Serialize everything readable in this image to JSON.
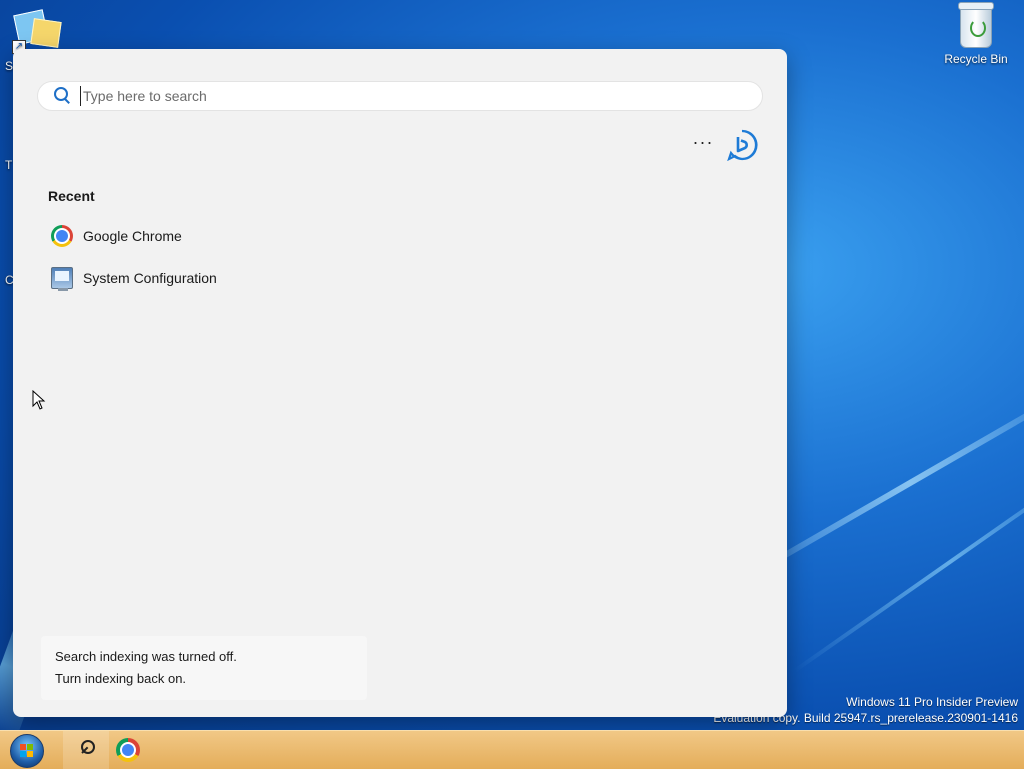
{
  "desktop": {
    "recycle_bin_label": "Recycle Bin",
    "top_left_icon_label": "S",
    "edge_letter_1": "T",
    "edge_letter_2": "C",
    "watermark_line1": "Windows 11 Pro Insider Preview",
    "watermark_line2": "Evaluation copy. Build 25947.rs_prerelease.230901-1416"
  },
  "search": {
    "placeholder": "Type here to search",
    "value": "",
    "more_label": "···",
    "recent_heading": "Recent",
    "recent_items": [
      {
        "label": "Google Chrome",
        "icon": "chrome-icon"
      },
      {
        "label": "System Configuration",
        "icon": "system-configuration-icon"
      }
    ],
    "indexing_notice": "Search indexing was turned off.",
    "indexing_link": "Turn indexing back on."
  },
  "taskbar": {
    "items": [
      "start-button",
      "search-button",
      "chrome-button"
    ]
  },
  "colors": {
    "accent": "#1e6fc7",
    "taskbar": "#e9b76a",
    "panel": "#f2f2f2"
  }
}
